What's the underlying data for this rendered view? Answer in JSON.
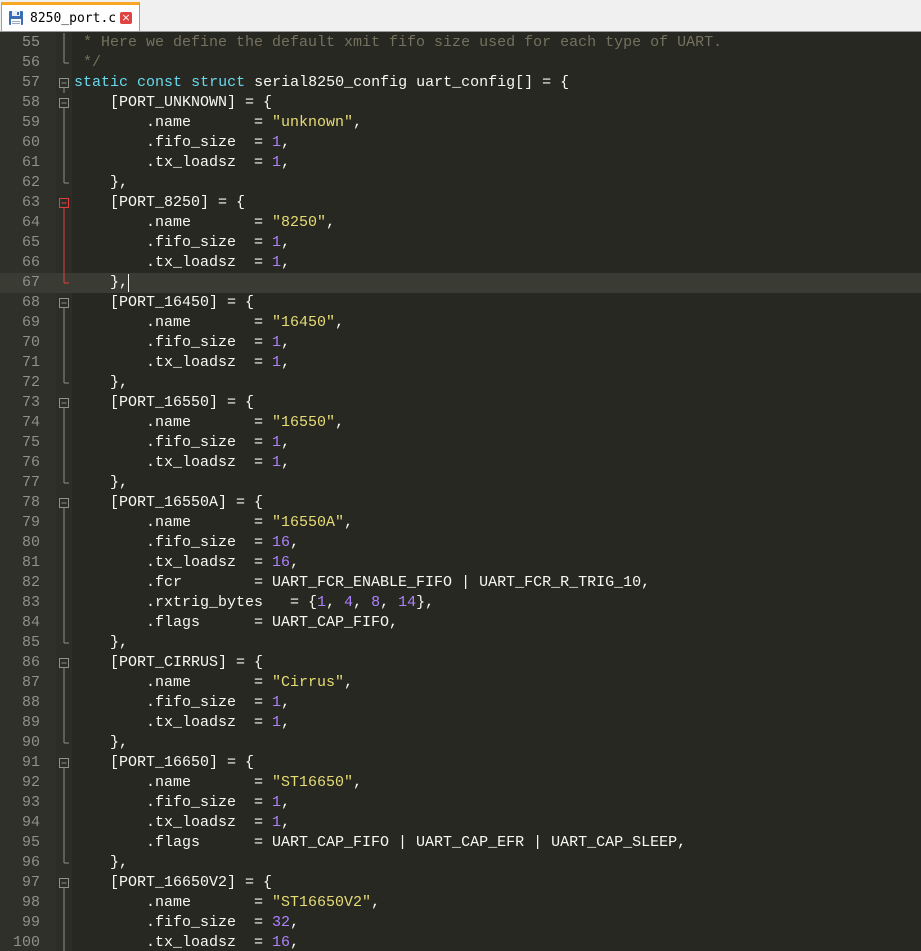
{
  "tab": {
    "title": "8250_port.c",
    "close_glyph": "×",
    "icon": "floppy-disk-icon"
  },
  "colors": {
    "comment": "#75715e",
    "keyword": "#66d9ef",
    "string": "#e6db74",
    "number": "#ae81ff",
    "plain": "#f8f8f2",
    "fold_marker": "#8f908a",
    "fold_marker_active": "#e04040"
  },
  "lines": [
    {
      "n": "55",
      "fold": "line",
      "tokens": [
        [
          " * Here we define the default xmit fifo size used for each type of UART.",
          "comment"
        ]
      ]
    },
    {
      "n": "56",
      "fold": "end",
      "tokens": [
        [
          " */",
          "comment"
        ]
      ]
    },
    {
      "n": "57",
      "fold": "open",
      "tokens": [
        [
          "static",
          "kw"
        ],
        [
          " ",
          "plain"
        ],
        [
          "const",
          "kw"
        ],
        [
          " ",
          "plain"
        ],
        [
          "struct",
          "kw"
        ],
        [
          " serial8250_config uart_config[] = {",
          "plain"
        ]
      ]
    },
    {
      "n": "58",
      "fold": "open",
      "tokens": [
        [
          "    [PORT_UNKNOWN] = {",
          "plain"
        ]
      ]
    },
    {
      "n": "59",
      "fold": "line",
      "tokens": [
        [
          "        .name       = ",
          "plain"
        ],
        [
          "\"unknown\"",
          "str"
        ],
        [
          ",",
          "plain"
        ]
      ]
    },
    {
      "n": "60",
      "fold": "line",
      "tokens": [
        [
          "        .fifo_size  = ",
          "plain"
        ],
        [
          "1",
          "num"
        ],
        [
          ",",
          "plain"
        ]
      ]
    },
    {
      "n": "61",
      "fold": "line",
      "tokens": [
        [
          "        .tx_loadsz  = ",
          "plain"
        ],
        [
          "1",
          "num"
        ],
        [
          ",",
          "plain"
        ]
      ]
    },
    {
      "n": "62",
      "fold": "end",
      "tokens": [
        [
          "    },",
          "plain"
        ]
      ]
    },
    {
      "n": "63",
      "fold": "open-active",
      "tokens": [
        [
          "    [PORT_8250] = {",
          "plain"
        ]
      ]
    },
    {
      "n": "64",
      "fold": "line-active",
      "tokens": [
        [
          "        .name       = ",
          "plain"
        ],
        [
          "\"8250\"",
          "str"
        ],
        [
          ",",
          "plain"
        ]
      ]
    },
    {
      "n": "65",
      "fold": "line-active",
      "tokens": [
        [
          "        .fifo_size  = ",
          "plain"
        ],
        [
          "1",
          "num"
        ],
        [
          ",",
          "plain"
        ]
      ]
    },
    {
      "n": "66",
      "fold": "line-active",
      "tokens": [
        [
          "        .tx_loadsz  = ",
          "plain"
        ],
        [
          "1",
          "num"
        ],
        [
          ",",
          "plain"
        ]
      ]
    },
    {
      "n": "67",
      "fold": "end-active",
      "caret": true,
      "tokens": [
        [
          "    },",
          "plain"
        ]
      ]
    },
    {
      "n": "68",
      "fold": "open",
      "tokens": [
        [
          "    [PORT_16450] = {",
          "plain"
        ]
      ]
    },
    {
      "n": "69",
      "fold": "line",
      "tokens": [
        [
          "        .name       = ",
          "plain"
        ],
        [
          "\"16450\"",
          "str"
        ],
        [
          ",",
          "plain"
        ]
      ]
    },
    {
      "n": "70",
      "fold": "line",
      "tokens": [
        [
          "        .fifo_size  = ",
          "plain"
        ],
        [
          "1",
          "num"
        ],
        [
          ",",
          "plain"
        ]
      ]
    },
    {
      "n": "71",
      "fold": "line",
      "tokens": [
        [
          "        .tx_loadsz  = ",
          "plain"
        ],
        [
          "1",
          "num"
        ],
        [
          ",",
          "plain"
        ]
      ]
    },
    {
      "n": "72",
      "fold": "end",
      "tokens": [
        [
          "    },",
          "plain"
        ]
      ]
    },
    {
      "n": "73",
      "fold": "open",
      "tokens": [
        [
          "    [PORT_16550] = {",
          "plain"
        ]
      ]
    },
    {
      "n": "74",
      "fold": "line",
      "tokens": [
        [
          "        .name       = ",
          "plain"
        ],
        [
          "\"16550\"",
          "str"
        ],
        [
          ",",
          "plain"
        ]
      ]
    },
    {
      "n": "75",
      "fold": "line",
      "tokens": [
        [
          "        .fifo_size  = ",
          "plain"
        ],
        [
          "1",
          "num"
        ],
        [
          ",",
          "plain"
        ]
      ]
    },
    {
      "n": "76",
      "fold": "line",
      "tokens": [
        [
          "        .tx_loadsz  = ",
          "plain"
        ],
        [
          "1",
          "num"
        ],
        [
          ",",
          "plain"
        ]
      ]
    },
    {
      "n": "77",
      "fold": "end",
      "tokens": [
        [
          "    },",
          "plain"
        ]
      ]
    },
    {
      "n": "78",
      "fold": "open",
      "tokens": [
        [
          "    [PORT_16550A] = {",
          "plain"
        ]
      ]
    },
    {
      "n": "79",
      "fold": "line",
      "tokens": [
        [
          "        .name       = ",
          "plain"
        ],
        [
          "\"16550A\"",
          "str"
        ],
        [
          ",",
          "plain"
        ]
      ]
    },
    {
      "n": "80",
      "fold": "line",
      "tokens": [
        [
          "        .fifo_size  = ",
          "plain"
        ],
        [
          "16",
          "num"
        ],
        [
          ",",
          "plain"
        ]
      ]
    },
    {
      "n": "81",
      "fold": "line",
      "tokens": [
        [
          "        .tx_loadsz  = ",
          "plain"
        ],
        [
          "16",
          "num"
        ],
        [
          ",",
          "plain"
        ]
      ]
    },
    {
      "n": "82",
      "fold": "line",
      "tokens": [
        [
          "        .fcr        = UART_FCR_ENABLE_FIFO | UART_FCR_R_TRIG_10,",
          "plain"
        ]
      ]
    },
    {
      "n": "83",
      "fold": "line",
      "tokens": [
        [
          "        .rxtrig_bytes   = {",
          "plain"
        ],
        [
          "1",
          "num"
        ],
        [
          ", ",
          "plain"
        ],
        [
          "4",
          "num"
        ],
        [
          ", ",
          "plain"
        ],
        [
          "8",
          "num"
        ],
        [
          ", ",
          "plain"
        ],
        [
          "14",
          "num"
        ],
        [
          "},",
          "plain"
        ]
      ]
    },
    {
      "n": "84",
      "fold": "line",
      "tokens": [
        [
          "        .flags      = UART_CAP_FIFO,",
          "plain"
        ]
      ]
    },
    {
      "n": "85",
      "fold": "end",
      "tokens": [
        [
          "    },",
          "plain"
        ]
      ]
    },
    {
      "n": "86",
      "fold": "open",
      "tokens": [
        [
          "    [PORT_CIRRUS] = {",
          "plain"
        ]
      ]
    },
    {
      "n": "87",
      "fold": "line",
      "tokens": [
        [
          "        .name       = ",
          "plain"
        ],
        [
          "\"Cirrus\"",
          "str"
        ],
        [
          ",",
          "plain"
        ]
      ]
    },
    {
      "n": "88",
      "fold": "line",
      "tokens": [
        [
          "        .fifo_size  = ",
          "plain"
        ],
        [
          "1",
          "num"
        ],
        [
          ",",
          "plain"
        ]
      ]
    },
    {
      "n": "89",
      "fold": "line",
      "tokens": [
        [
          "        .tx_loadsz  = ",
          "plain"
        ],
        [
          "1",
          "num"
        ],
        [
          ",",
          "plain"
        ]
      ]
    },
    {
      "n": "90",
      "fold": "end",
      "tokens": [
        [
          "    },",
          "plain"
        ]
      ]
    },
    {
      "n": "91",
      "fold": "open",
      "tokens": [
        [
          "    [PORT_16650] = {",
          "plain"
        ]
      ]
    },
    {
      "n": "92",
      "fold": "line",
      "tokens": [
        [
          "        .name       = ",
          "plain"
        ],
        [
          "\"ST16650\"",
          "str"
        ],
        [
          ",",
          "plain"
        ]
      ]
    },
    {
      "n": "93",
      "fold": "line",
      "tokens": [
        [
          "        .fifo_size  = ",
          "plain"
        ],
        [
          "1",
          "num"
        ],
        [
          ",",
          "plain"
        ]
      ]
    },
    {
      "n": "94",
      "fold": "line",
      "tokens": [
        [
          "        .tx_loadsz  = ",
          "plain"
        ],
        [
          "1",
          "num"
        ],
        [
          ",",
          "plain"
        ]
      ]
    },
    {
      "n": "95",
      "fold": "line",
      "tokens": [
        [
          "        .flags      = UART_CAP_FIFO | UART_CAP_EFR | UART_CAP_SLEEP,",
          "plain"
        ]
      ]
    },
    {
      "n": "96",
      "fold": "end",
      "tokens": [
        [
          "    },",
          "plain"
        ]
      ]
    },
    {
      "n": "97",
      "fold": "open",
      "tokens": [
        [
          "    [PORT_16650V2] = {",
          "plain"
        ]
      ]
    },
    {
      "n": "98",
      "fold": "line",
      "tokens": [
        [
          "        .name       = ",
          "plain"
        ],
        [
          "\"ST16650V2\"",
          "str"
        ],
        [
          ",",
          "plain"
        ]
      ]
    },
    {
      "n": "99",
      "fold": "line",
      "tokens": [
        [
          "        .fifo_size  = ",
          "plain"
        ],
        [
          "32",
          "num"
        ],
        [
          ",",
          "plain"
        ]
      ]
    },
    {
      "n": "100",
      "fold": "line",
      "tokens": [
        [
          "        .tx_loadsz  = ",
          "plain"
        ],
        [
          "16",
          "num"
        ],
        [
          ",",
          "plain"
        ]
      ]
    }
  ]
}
